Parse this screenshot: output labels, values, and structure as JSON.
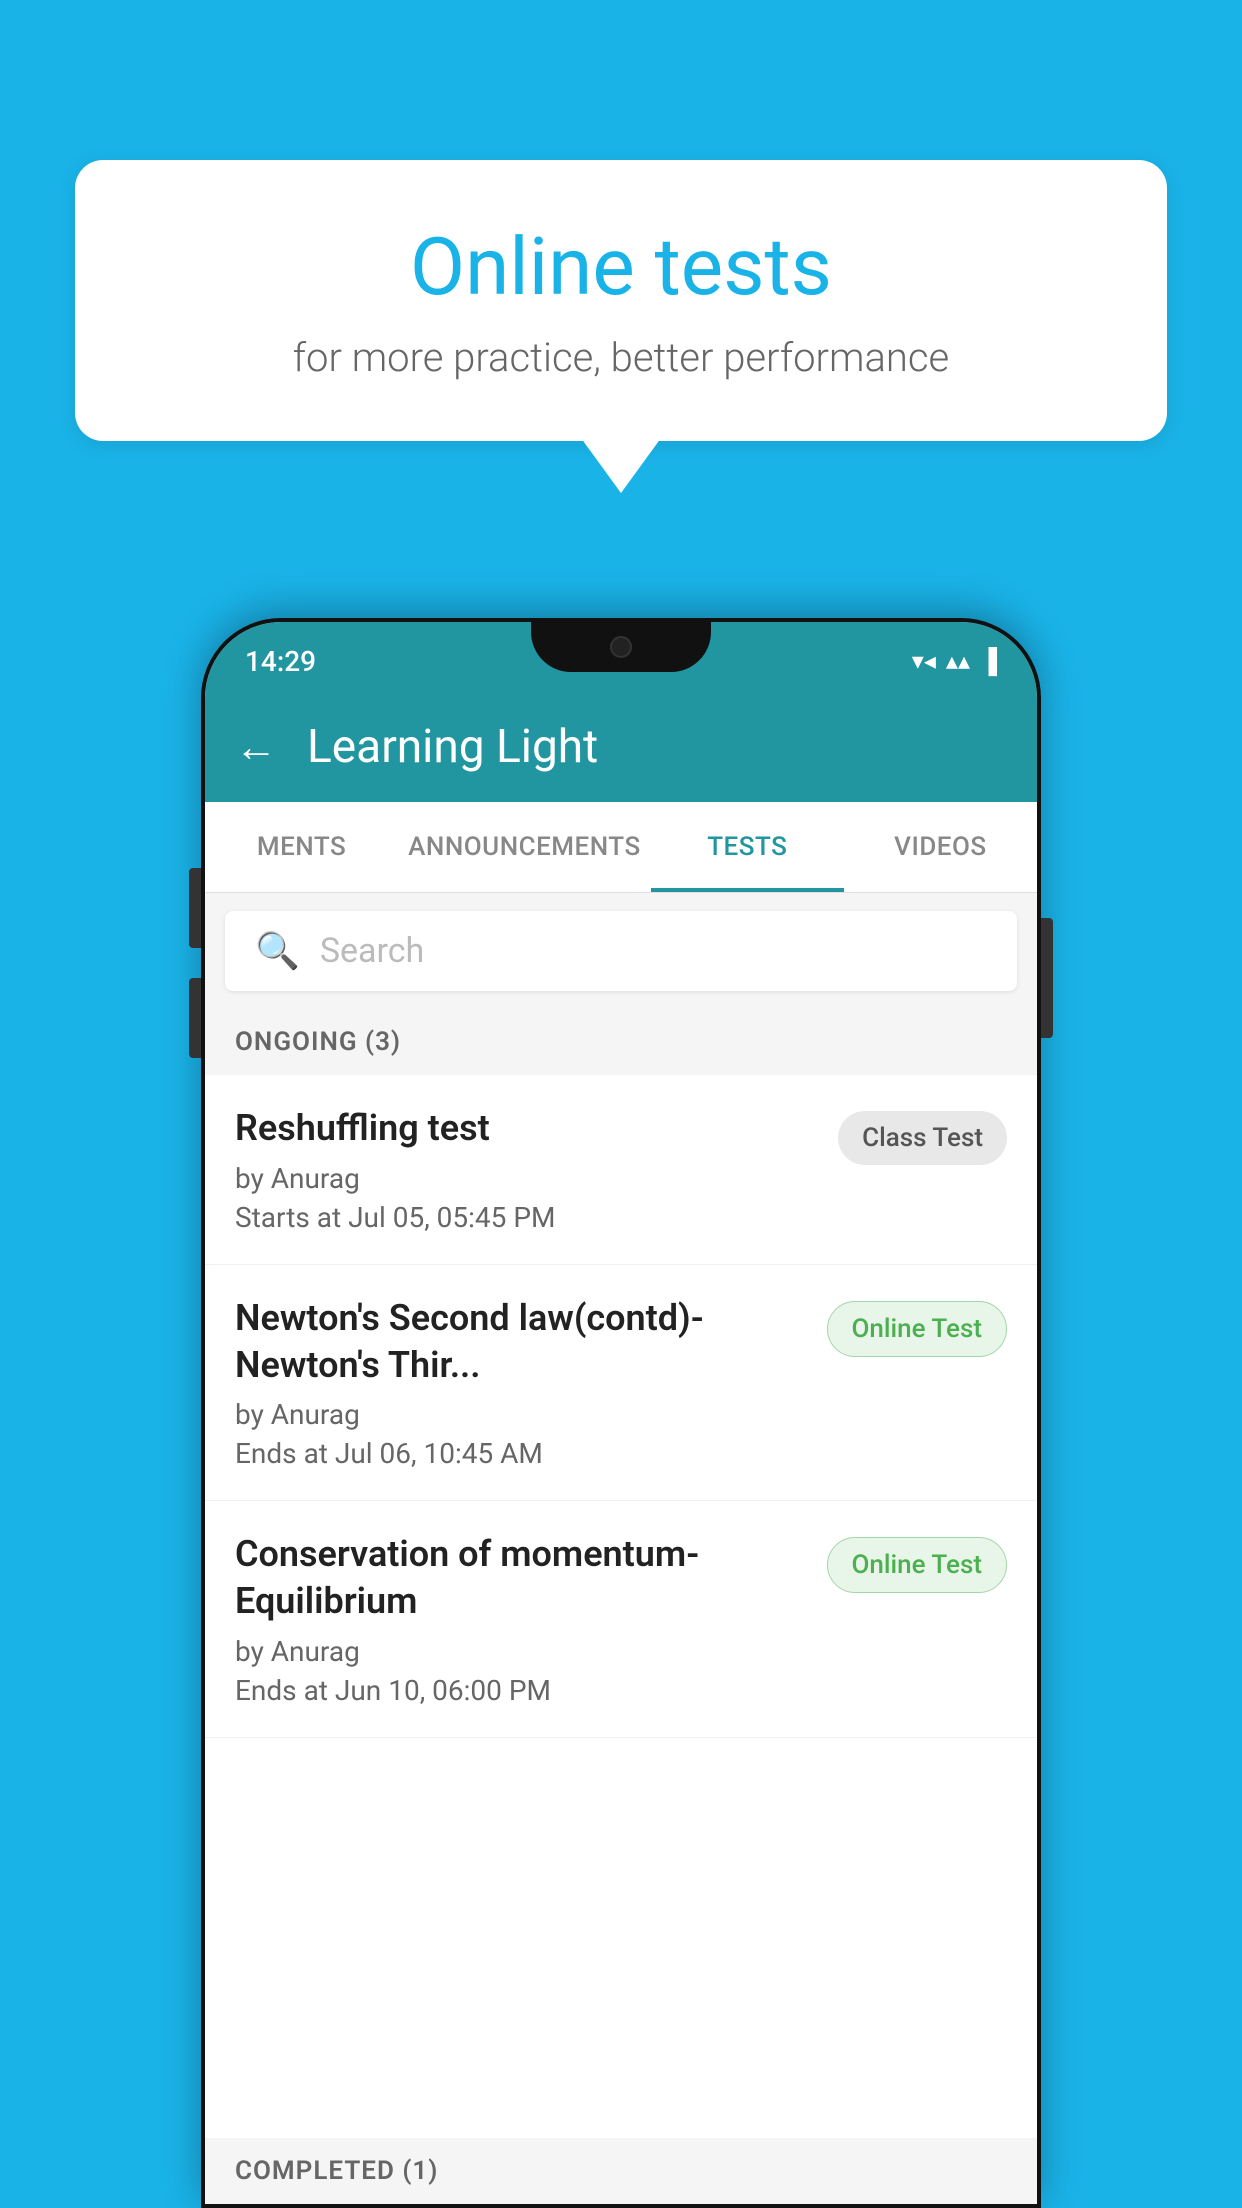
{
  "background_color": "#1ab3e8",
  "speech_bubble": {
    "title": "Online tests",
    "subtitle": "for more practice, better performance"
  },
  "phone": {
    "status_bar": {
      "time": "14:29",
      "wifi": "▼",
      "signal": "▲",
      "battery": "▌"
    },
    "app_bar": {
      "back_label": "←",
      "title": "Learning Light"
    },
    "tabs": [
      {
        "label": "MENTS",
        "active": false
      },
      {
        "label": "ANNOUNCEMENTS",
        "active": false
      },
      {
        "label": "TESTS",
        "active": true
      },
      {
        "label": "VIDEOS",
        "active": false
      }
    ],
    "search": {
      "placeholder": "Search",
      "icon": "🔍"
    },
    "ongoing_section": {
      "label": "ONGOING (3)",
      "tests": [
        {
          "title": "Reshuffling test",
          "author": "by Anurag",
          "time_label": "Starts at",
          "time": "Jul 05, 05:45 PM",
          "badge": "Class Test",
          "badge_type": "class"
        },
        {
          "title": "Newton's Second law(contd)-Newton's Thir...",
          "author": "by Anurag",
          "time_label": "Ends at",
          "time": "Jul 06, 10:45 AM",
          "badge": "Online Test",
          "badge_type": "online"
        },
        {
          "title": "Conservation of momentum-Equilibrium",
          "author": "by Anurag",
          "time_label": "Ends at",
          "time": "Jun 10, 06:00 PM",
          "badge": "Online Test",
          "badge_type": "online"
        }
      ]
    },
    "completed_section": {
      "label": "COMPLETED (1)"
    }
  }
}
